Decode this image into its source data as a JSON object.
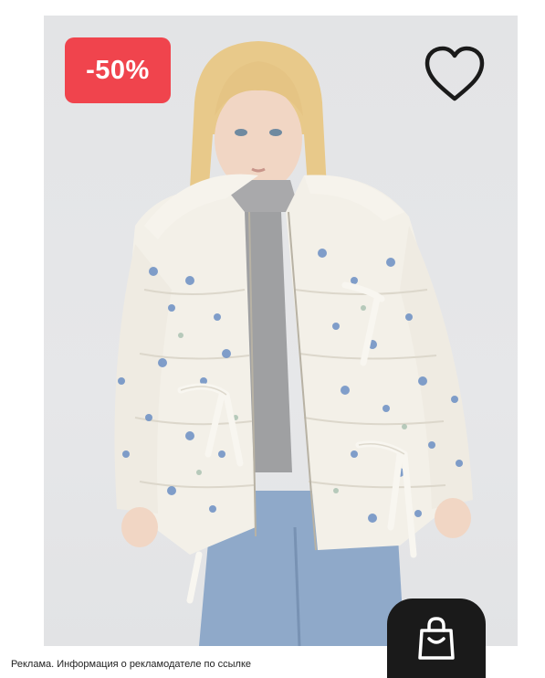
{
  "product_card": {
    "discount_badge": "-50%",
    "ad_disclaimer": "Реклама. Информация о рекламодателе по ссылке"
  },
  "icons": {
    "favorite": "heart-outline-icon",
    "cart": "shopping-bag-icon"
  },
  "colors": {
    "badge_bg": "#f0444d",
    "cart_button_bg": "#1a1a1a",
    "photo_bg": "#e4e5e7"
  }
}
